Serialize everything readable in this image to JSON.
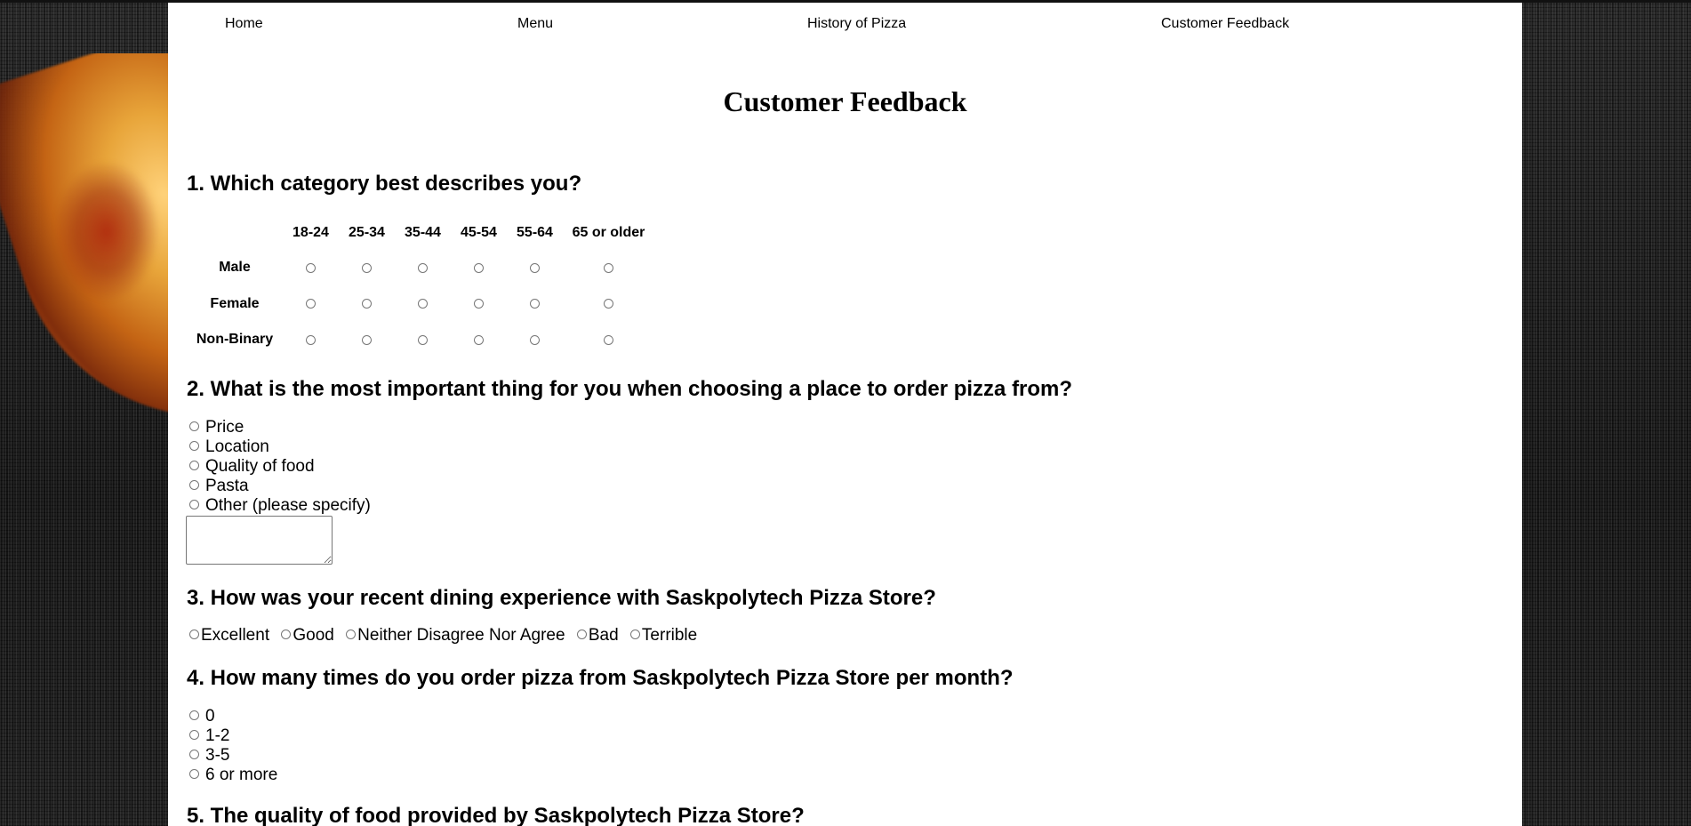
{
  "nav": {
    "items": [
      "Home",
      "Menu",
      "History of Pizza",
      "Customer Feedback"
    ]
  },
  "page_title": "Customer Feedback",
  "q1": {
    "title": "1. Which category best describes you?",
    "age_groups": [
      "18-24",
      "25-34",
      "35-44",
      "45-54",
      "55-64",
      "65 or older"
    ],
    "genders": [
      "Male",
      "Female",
      "Non-Binary"
    ]
  },
  "q2": {
    "title": "2. What is the most important thing for you when choosing a place to order pizza from?",
    "options": [
      "Price",
      "Location",
      "Quality of food",
      "Pasta",
      "Other (please specify)"
    ],
    "other_value": ""
  },
  "q3": {
    "title": "3. How was your recent dining experience with Saskpolytech Pizza Store?",
    "options": [
      "Excellent",
      "Good",
      "Neither Disagree Nor Agree",
      "Bad",
      "Terrible"
    ]
  },
  "q4": {
    "title": "4. How many times do you order pizza from Saskpolytech Pizza Store per month?",
    "options": [
      "0",
      "1-2",
      "3-5",
      "6 or more"
    ]
  },
  "q5": {
    "title": "5. The quality of food provided by Saskpolytech Pizza Store?"
  },
  "colors": {
    "background": "#1d1d1d",
    "panel": "#ffffff",
    "text": "#000000",
    "radio_border": "#767676"
  }
}
